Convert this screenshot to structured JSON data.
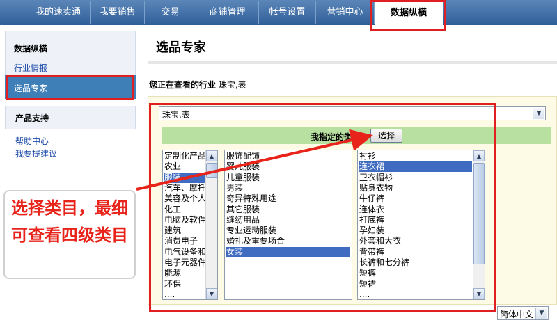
{
  "nav": {
    "tabs": [
      {
        "label": "我的速卖通"
      },
      {
        "label": "我要销售"
      },
      {
        "label": "交易"
      },
      {
        "label": "商铺管理"
      },
      {
        "label": "帐号设置"
      },
      {
        "label": "营销中心"
      },
      {
        "label": "数据纵横",
        "active": true
      }
    ]
  },
  "sidebar": {
    "section1_title": "数据纵横",
    "industry_link": "行业情报",
    "selected_item": "选品专家",
    "section2_title": "产品支持",
    "help_link": "帮助中心",
    "suggest_link": "我要提建议"
  },
  "main": {
    "page_title": "选品专家",
    "industry_prefix": "您正在查看的行业",
    "industry_value": "珠宝,表",
    "industry_select_value": "珠宝,表",
    "category_bar_label": "我指定的类目.",
    "choose_button": "选择",
    "list1": [
      "定制化产品",
      "农业",
      "服装",
      "汽车、摩托",
      "美容及个人",
      "化工",
      "电脑及软件",
      "建筑",
      "消费电子",
      "电气设备和",
      "电子元器件",
      "能源",
      "环保",
      "...."
    ],
    "list1_selected": "服装",
    "list2": [
      "服饰配饰",
      "婴儿服装",
      "儿童服装",
      "男装",
      "奇异特殊用途",
      "其它服装",
      "缝纫用品",
      "专业运动服装",
      "婚礼及重要场合",
      "女装"
    ],
    "list2_selected": "女装",
    "list3": [
      "衬衫",
      "连衣裙",
      "卫衣帽衫",
      "贴身衣物",
      "牛仔裤",
      "连体衣",
      "打底裤",
      "孕妇装",
      "外套和大衣",
      "背带裤",
      "长裤和七分裤",
      "短裤",
      "短裙",
      "...."
    ],
    "list3_selected": "连衣裙",
    "language_select": "简体中文"
  },
  "annotation": {
    "callout_text": "选择类目，最细可查看四级类目",
    "highlight_color": "#e02020"
  },
  "colors": {
    "nav_bar": "#3a6aa3",
    "sidebar_selected": "#3e7fb8",
    "category_bar": "#b8e0a0",
    "list_selection": "#3f6cc1"
  }
}
